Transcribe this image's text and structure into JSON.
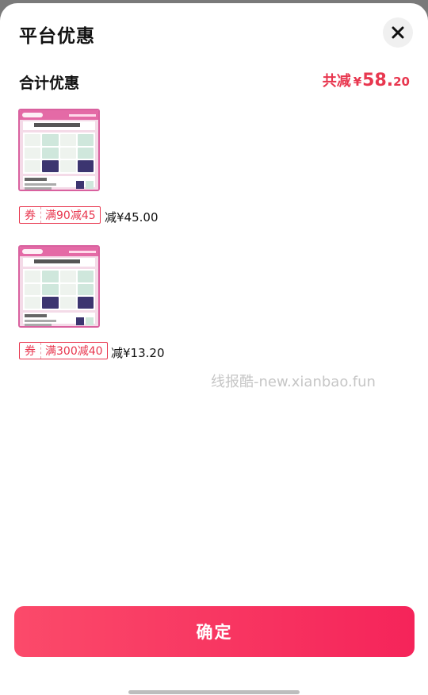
{
  "sheet": {
    "title": "平台优惠",
    "close_icon": "close-icon"
  },
  "summary": {
    "label": "合计优惠",
    "total_prefix": "共减",
    "currency": "¥",
    "total_integer": "58.",
    "total_decimal": "20"
  },
  "items": [
    {
      "coupon_kind": "券",
      "coupon_rule": "满90减45",
      "discount": "减¥45.00"
    },
    {
      "coupon_kind": "券",
      "coupon_rule": "满300减40",
      "discount": "减¥13.20"
    }
  ],
  "watermark": "线报酷-new.xianbao.fun",
  "confirm_label": "确定",
  "colors": {
    "accent": "#e8374f",
    "button_start": "#fb4a6a",
    "button_end": "#f5245a"
  }
}
